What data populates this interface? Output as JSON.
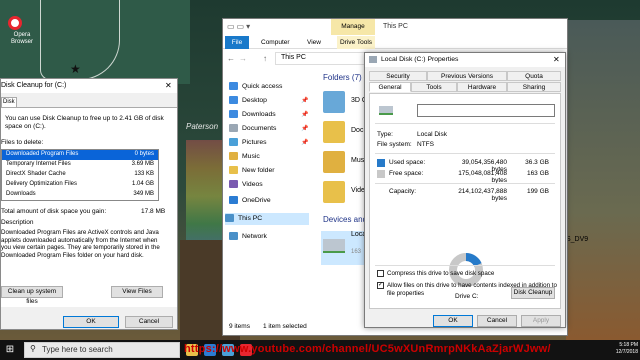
{
  "desktop": {
    "opera_label": "Opera Browser",
    "paterson_text": "Paterson",
    "dv9_text": "S_DV9"
  },
  "taskbar": {
    "start_glyph": "⊞",
    "search_placeholder": "Type here to search",
    "url_overlay": "https://www.youtube.com/channel/UC5wXUnRmrpNKkAaZjarWJww/",
    "clock_time": "5:18 PM",
    "clock_date": "12/7/2018"
  },
  "cleanup": {
    "title": "Disk Cleanup for (C:)",
    "close_glyph": "✕",
    "tab_label": "Disk Cleanup",
    "description": "You can use Disk Cleanup to free up to 2.41 GB of disk space on (C:).",
    "files_label": "Files to delete:",
    "files": [
      {
        "name": "Downloaded Program Files",
        "size": "0 bytes",
        "selected": true
      },
      {
        "name": "Temporary Internet Files",
        "size": "3.69 MB",
        "selected": false
      },
      {
        "name": "DirectX Shader Cache",
        "size": "133 KB",
        "selected": false
      },
      {
        "name": "Delivery Optimization Files",
        "size": "1.04 GB",
        "selected": false
      },
      {
        "name": "Downloads",
        "size": "349 MB",
        "selected": false
      }
    ],
    "total_label": "Total amount of disk space you gain:",
    "total_value": "17.8 MB",
    "description_label": "Description",
    "description_text": "Downloaded Program Files are ActiveX controls and Java applets downloaded automatically from the Internet when you view certain pages. They are temporarily stored in the Downloaded Program Files folder on your hard disk.",
    "clean_system_button": "Clean up system files",
    "view_files_button": "View Files",
    "ok_button": "OK",
    "cancel_button": "Cancel"
  },
  "explorer": {
    "manage_label": "Manage",
    "title": "This PC",
    "ribbon_tabs": {
      "file": "File",
      "computer": "Computer",
      "view": "View",
      "drive_tools": "Drive Tools"
    },
    "address": "This PC",
    "sidebar": [
      {
        "label": "Quick access",
        "icon": "star-icon",
        "color": "#3c8ae0",
        "pinned": false
      },
      {
        "label": "Desktop",
        "icon": "desktop-icon",
        "color": "#3c8ae0",
        "pinned": true
      },
      {
        "label": "Downloads",
        "icon": "download-icon",
        "color": "#3c8ae0",
        "pinned": true
      },
      {
        "label": "Documents",
        "icon": "documents-icon",
        "color": "#9aa7b4",
        "pinned": true
      },
      {
        "label": "Pictures",
        "icon": "pictures-icon",
        "color": "#4aa0d8",
        "pinned": true
      },
      {
        "label": "Music",
        "icon": "music-icon",
        "color": "#e0b040",
        "pinned": false
      },
      {
        "label": "New folder",
        "icon": "folder-icon",
        "color": "#e8c04a",
        "pinned": false
      },
      {
        "label": "Videos",
        "icon": "videos-icon",
        "color": "#7a5ab0",
        "pinned": false
      },
      {
        "label": "OneDrive",
        "icon": "cloud-icon",
        "color": "#2b7cd3",
        "pinned": false
      },
      {
        "label": "This PC",
        "icon": "computer-icon",
        "color": "#4a90c8",
        "pinned": false,
        "selected": true
      },
      {
        "label": "Network",
        "icon": "network-icon",
        "color": "#4a90c8",
        "pinned": false
      }
    ],
    "folders_header": "Folders (7)",
    "folders": [
      {
        "label": "3D O",
        "color": "#68a8d8"
      },
      {
        "label": "Doc",
        "color": "#e8c04a"
      },
      {
        "label": "Mus",
        "color": "#e0b040"
      },
      {
        "label": "Vide",
        "color": "#e8c04a"
      }
    ],
    "devices_header": "Devices and",
    "drive_label": "Loca",
    "drive_free": "163",
    "status_items": "9 items",
    "status_selected": "1 item selected"
  },
  "props": {
    "title": "Local Disk (C:) Properties",
    "close_glyph": "✕",
    "tabs_row1": [
      "Security",
      "Previous Versions",
      "Quota"
    ],
    "tabs_row2": [
      "General",
      "Tools",
      "Hardware",
      "Sharing"
    ],
    "active_tab": "General",
    "name_value": "",
    "type_label": "Type:",
    "type_value": "Local Disk",
    "fs_label": "File system:",
    "fs_value": "NTFS",
    "used_label": "Used space:",
    "used_bytes": "39,054,356,480 bytes",
    "used_gb": "36.3 GB",
    "used_color": "#267ac9",
    "free_label": "Free space:",
    "free_bytes": "175,048,081,408 bytes",
    "free_gb": "163 GB",
    "free_color": "#c8c8c8",
    "capacity_label": "Capacity:",
    "capacity_bytes": "214,102,437,888 bytes",
    "capacity_gb": "199 GB",
    "used_fraction": 0.182,
    "drive_caption": "Drive C:",
    "disk_cleanup_button": "Disk Cleanup",
    "compress_label": "Compress this drive to save disk space",
    "compress_checked": false,
    "index_label": "Allow files on this drive to have contents indexed in addition to file properties",
    "index_checked": true,
    "ok_button": "OK",
    "cancel_button": "Cancel",
    "apply_button": "Apply"
  }
}
